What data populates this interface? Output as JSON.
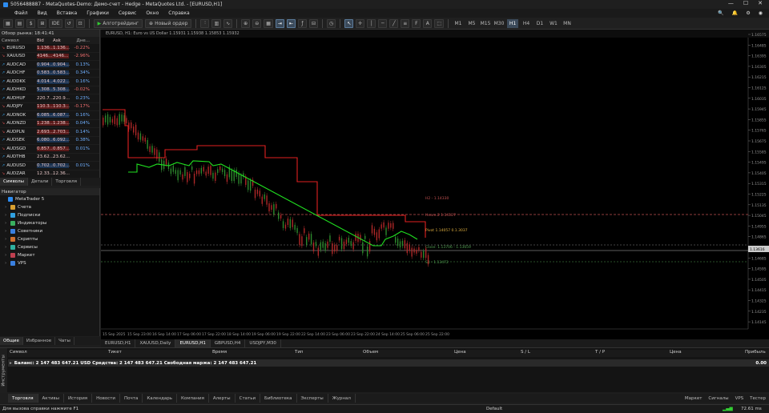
{
  "title": "5056488887 - MetaQuotes-Demo: Демо-счет - Hedge - MetaQuotes Ltd. - [EURUSD,H1]",
  "menu": [
    "Файл",
    "Вид",
    "Вставка",
    "Графики",
    "Сервис",
    "Окно",
    "Справка"
  ],
  "toolbar": {
    "algo_label": "Алготрейдинг",
    "new_order_label": "Новый ордер",
    "timeframes": [
      "M1",
      "M5",
      "M15",
      "M30",
      "H1",
      "H4",
      "D1",
      "W1",
      "MN"
    ],
    "active_tf": "H1"
  },
  "market_watch": {
    "title": "Обзор рынка: 18:41:41",
    "columns": [
      "Символ",
      "Bid",
      "Ask",
      "Дне..."
    ],
    "rows": [
      {
        "sym": "EURUSD",
        "bid": "1.136...",
        "ask": "1.136...",
        "chg": "-0.22%",
        "dir": "down",
        "bg": "red"
      },
      {
        "sym": "XAUUSD",
        "bid": "4146...",
        "ask": "4146...",
        "chg": "-2.96%",
        "dir": "down",
        "bg": "red"
      },
      {
        "sym": "AUDCAD",
        "bid": "0.904...",
        "ask": "0.904...",
        "chg": "0.13%",
        "dir": "up",
        "bg": "blue"
      },
      {
        "sym": "AUDCHF",
        "bid": "0.583...",
        "ask": "0.583...",
        "chg": "0.34%",
        "dir": "up",
        "bg": "blue"
      },
      {
        "sym": "AUDDKK",
        "bid": "4.014...",
        "ask": "4.022...",
        "chg": "0.16%",
        "dir": "up",
        "bg": "blue"
      },
      {
        "sym": "AUDHKD",
        "bid": "5.308...",
        "ask": "5.308...",
        "chg": "-0.02%",
        "dir": "up",
        "bg": "blue"
      },
      {
        "sym": "AUDHUF",
        "bid": "220.7...",
        "ask": "220.9...",
        "chg": "0.23%",
        "dir": "up",
        "bg": "none"
      },
      {
        "sym": "AUDJPY",
        "bid": "110.3...",
        "ask": "110.3...",
        "chg": "-0.17%",
        "dir": "down",
        "bg": "red"
      },
      {
        "sym": "AUDNOK",
        "bid": "6.085...",
        "ask": "6.087...",
        "chg": "0.16%",
        "dir": "up",
        "bg": "blue"
      },
      {
        "sym": "AUDNZD",
        "bid": "1.238...",
        "ask": "1.238...",
        "chg": "0.04%",
        "dir": "down",
        "bg": "red"
      },
      {
        "sym": "AUDPLN",
        "bid": "2.693...",
        "ask": "2.703...",
        "chg": "0.14%",
        "dir": "down",
        "bg": "red"
      },
      {
        "sym": "AUDSEK",
        "bid": "6.080...",
        "ask": "6.092...",
        "chg": "0.38%",
        "dir": "up",
        "bg": "blue"
      },
      {
        "sym": "AUDSGD",
        "bid": "0.857...",
        "ask": "0.857...",
        "chg": "0.01%",
        "dir": "down",
        "bg": "red"
      },
      {
        "sym": "AUDTHB",
        "bid": "23.62...",
        "ask": "23.62...",
        "chg": "",
        "dir": "up",
        "bg": "none"
      },
      {
        "sym": "AUDUSD",
        "bid": "0.702...",
        "ask": "0.702...",
        "chg": "0.01%",
        "dir": "up",
        "bg": "blue"
      },
      {
        "sym": "AUDZAR",
        "bid": "12.33...",
        "ask": "12.36...",
        "chg": "",
        "dir": "down",
        "bg": "none"
      }
    ],
    "tabs": [
      "Символы",
      "Детали",
      "Торговля"
    ]
  },
  "navigator": {
    "title": "Навигатор",
    "items": [
      {
        "label": "MetaTrader 5",
        "color": "#2d8cf0"
      },
      {
        "label": "Счета",
        "color": "#d9a030"
      },
      {
        "label": "Подписки",
        "color": "#30a0e0"
      },
      {
        "label": "Индикаторы",
        "color": "#3ab060"
      },
      {
        "label": "Советники",
        "color": "#3a80e0"
      },
      {
        "label": "Скрипты",
        "color": "#d07030"
      },
      {
        "label": "Сервисы",
        "color": "#30b0a0"
      },
      {
        "label": "Маркет",
        "color": "#c04050"
      },
      {
        "label": "VPS",
        "color": "#3a80e0"
      }
    ],
    "tabs": [
      "Общие",
      "Избранное",
      "Чаты"
    ]
  },
  "chart": {
    "header": "EURUSD, H1: Euro vs US Dollar 1.15931 1.15938 1.15853 1.15932",
    "tabs": [
      "EURUSD,H1",
      "XAUUSD,Daily",
      "EURUSD,H1",
      "GBPUSD,H4",
      "USDJPY,M30"
    ],
    "active_tab": 2,
    "price_labels": [
      "1.16575",
      "1.16485",
      "1.16395",
      "1.16305",
      "1.16215",
      "1.16125",
      "1.16035",
      "1.15945",
      "1.15855",
      "1.15765",
      "1.15675",
      "1.15585",
      "1.15495",
      "1.15405",
      "1.15315",
      "1.15225",
      "1.15135",
      "1.15045",
      "1.14955",
      "1.14865",
      "1.14775",
      "1.14685",
      "1.14595",
      "1.14505",
      "1.14415",
      "1.14325",
      "1.14235",
      "1.14145"
    ],
    "current_price": "1.13616",
    "time_labels": [
      "15 Sep 2025",
      "15 Sep 23:00",
      "16 Sep 14:00",
      "17 Sep 06:00",
      "17 Sep 22:00",
      "18 Sep 14:00",
      "19 Sep 06:00",
      "19 Sep 22:00",
      "22 Sep 14:00",
      "23 Sep 06:00",
      "23 Sep 22:00",
      "24 Sep 14:00",
      "25 Sep 06:00",
      "25 Sep 22:00"
    ],
    "annotations": {
      "h2": "H2 - 1.14330",
      "h3": "Heure.2 1.14127",
      "pivot": "Pivot 1.14057 0.1.3037",
      "s1": "Close: 1.13706 - 1.13659",
      "s2": "S3 - 1.13472"
    }
  },
  "toolbox": {
    "vertical_label": "Инструменты",
    "columns": [
      "Символ",
      "Тикет",
      "Время",
      "Тип",
      "Объем",
      "Цена",
      "S / L",
      "T / P",
      "Цена",
      "Прибыль"
    ],
    "balance_row": "Баланс: 2 147 483 647.21 USD  Средства: 2 147 483 647.21  Свободная маржа: 2 147 483 647.21",
    "balance_value": "0.00",
    "tabs": [
      "Торговля",
      "Активы",
      "История",
      "Новости",
      "Почта",
      "Календарь",
      "Компания",
      "Алерты",
      "Статьи",
      "Библиотека",
      "Эксперты",
      "Журнал"
    ],
    "right_items": [
      "Маркет",
      "Сигналы",
      "VPS",
      "Тестер"
    ]
  },
  "status": {
    "help": "Для вызова справки нажмите F1",
    "profile": "Default",
    "ping": "72.61 ms"
  }
}
